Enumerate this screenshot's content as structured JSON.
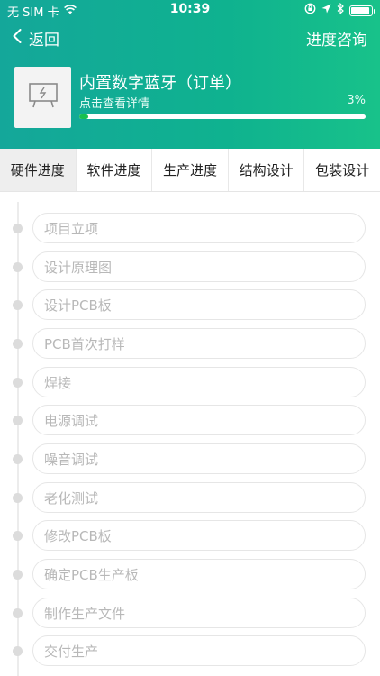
{
  "status_bar": {
    "carrier": "无 SIM 卡",
    "time": "10:39"
  },
  "nav": {
    "back_label": "返回",
    "action_label": "进度咨询"
  },
  "product": {
    "title": "内置数字蓝牙（订单）",
    "subtitle": "点击查看详情",
    "progress_label": "3%",
    "progress_fraction": 0.03
  },
  "tabs": [
    {
      "label": "硬件进度",
      "active": true
    },
    {
      "label": "软件进度",
      "active": false
    },
    {
      "label": "生产进度",
      "active": false
    },
    {
      "label": "结构设计",
      "active": false
    },
    {
      "label": "包装设计",
      "active": false
    }
  ],
  "steps": [
    {
      "label": "项目立项"
    },
    {
      "label": "设计原理图"
    },
    {
      "label": "设计PCB板"
    },
    {
      "label": "PCB首次打样"
    },
    {
      "label": "焊接"
    },
    {
      "label": "电源调试"
    },
    {
      "label": "噪音调试"
    },
    {
      "label": "老化测试"
    },
    {
      "label": "修改PCB板"
    },
    {
      "label": "确定PCB生产板"
    },
    {
      "label": "制作生产文件"
    },
    {
      "label": "交付生产"
    }
  ],
  "colors": {
    "header_start": "#14a79a",
    "header_end": "#18c28a",
    "progress_fill": "#18c04f",
    "inactive_text": "#b8b8b8"
  }
}
